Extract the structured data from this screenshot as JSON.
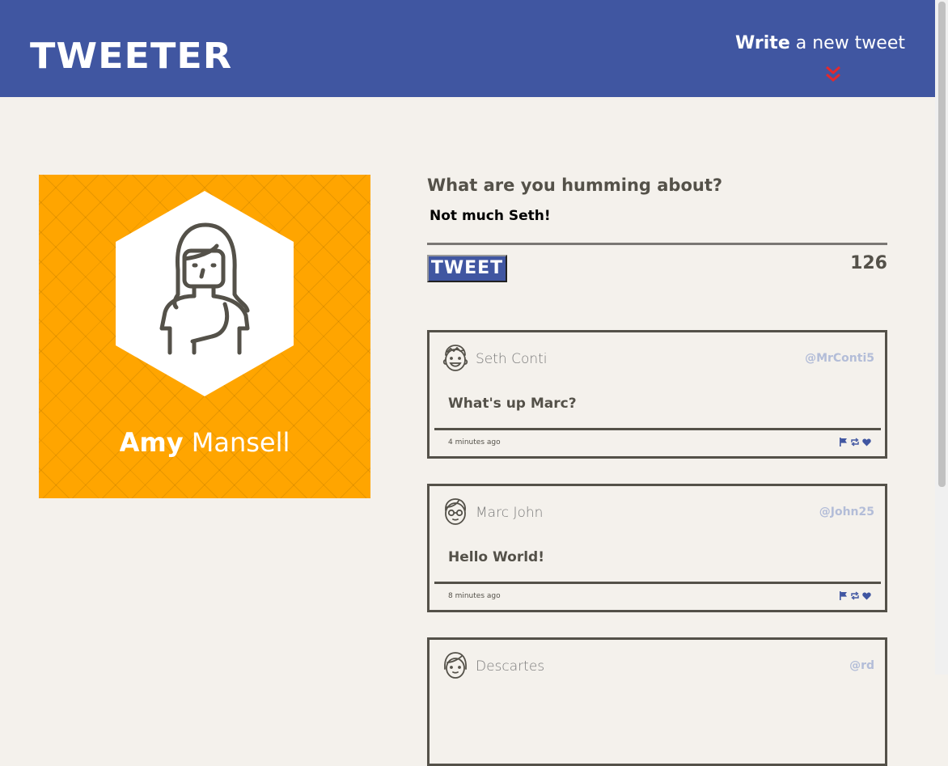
{
  "header": {
    "logo": "TWEETER",
    "write_bold": "Write",
    "write_rest": " a new tweet",
    "accent": "#4056a1",
    "chevron_color": "#e5282c"
  },
  "profile": {
    "first_name": "Amy",
    "last_name": "Mansell",
    "background": "#ffa500"
  },
  "compose": {
    "question": "What are you humming about?",
    "text": "Not much Seth!",
    "button": "TWEET",
    "counter": "126"
  },
  "tweets": [
    {
      "name": "Seth Conti",
      "handle": "@MrConti5",
      "content": "What's up Marc?",
      "time": "4 minutes ago"
    },
    {
      "name": "Marc John",
      "handle": "@John25",
      "content": "Hello World!",
      "time": "8 minutes ago"
    },
    {
      "name": "Descartes",
      "handle": "@rd",
      "content": "",
      "time": ""
    }
  ]
}
